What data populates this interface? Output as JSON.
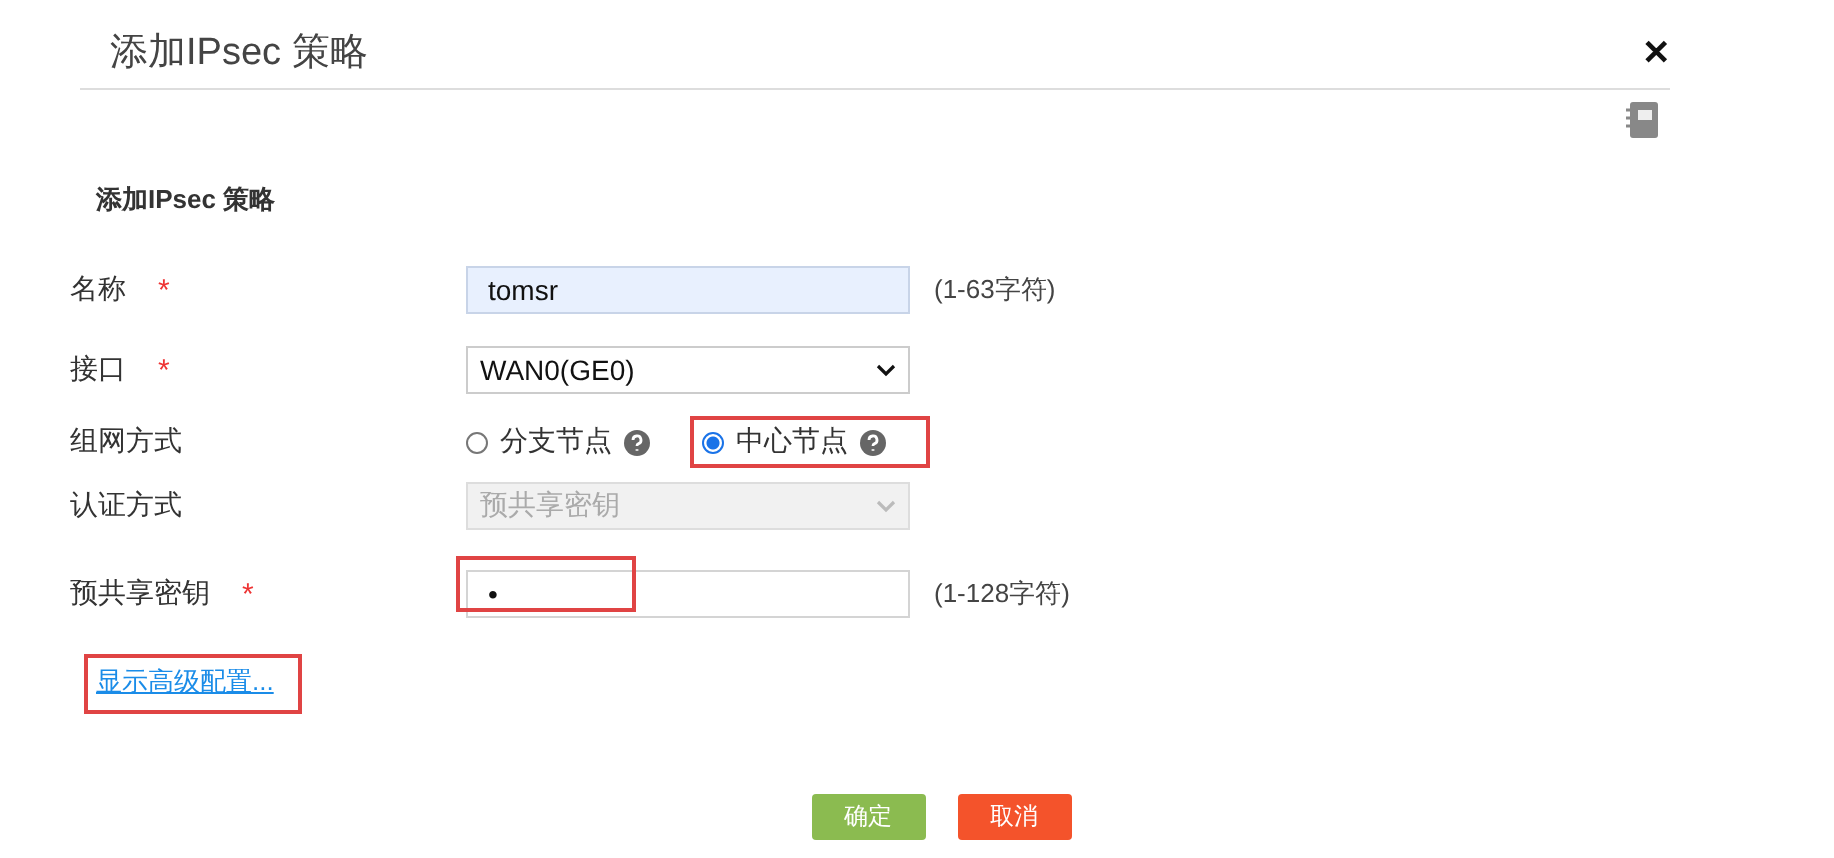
{
  "dialog": {
    "title": "添加IPsec 策略",
    "close": "✕"
  },
  "section_title": "添加IPsec 策略",
  "fields": [
    {
      "kind": "text",
      "label": "名称",
      "required_mark": "*",
      "value": "tomsr",
      "hint": "(1-63字符)",
      "autofilled": true
    },
    {
      "kind": "select",
      "label": "接口",
      "required_mark": "*",
      "value": "WAN0(GE0)",
      "disabled": false
    },
    {
      "kind": "radio",
      "label": "组网方式",
      "options": [
        {
          "label": "分支节点",
          "selected": false,
          "highlighted": false
        },
        {
          "label": "中心节点",
          "selected": true,
          "highlighted": true
        }
      ]
    },
    {
      "kind": "select",
      "label": "认证方式",
      "value": "预共享密钥",
      "disabled": true
    },
    {
      "kind": "text",
      "label": "预共享密钥",
      "required_mark": "*",
      "value": "•",
      "hint": "(1-128字符)",
      "autofilled": false,
      "highlighted": true
    }
  ],
  "advanced_link": {
    "label": "显示高级配置...",
    "highlighted": true
  },
  "buttons": [
    {
      "label": "确定",
      "kind": "primary"
    },
    {
      "label": "取消",
      "kind": "danger"
    }
  ]
}
